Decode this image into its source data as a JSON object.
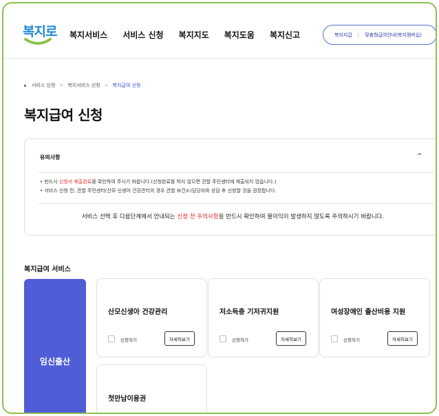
{
  "brand": {
    "logo_text": "복지로",
    "logo_color": "#1e88d6",
    "accent": "#4f5dd6",
    "frame_color": "#8cc152"
  },
  "nav": {
    "items": [
      "복지서비스",
      "서비스 신청",
      "복지지도",
      "복지도움",
      "복지신고"
    ]
  },
  "util": {
    "link1": "복지지갑",
    "separator": "|",
    "link2": "맞춤형급여안내(복지멤버십)"
  },
  "breadcrumb": {
    "items": [
      "서비스 신청",
      "복지서비스 신청",
      "복지급여 신청"
    ],
    "separator": ">"
  },
  "page": {
    "title": "복지급여 신청"
  },
  "notice": {
    "title": "유의사항",
    "toggle_icon": "^",
    "line1_prefix": "• 반드시 ",
    "line1_highlight": "신청서 제출완료",
    "line1_suffix": "를 확인하여 주시기 바랍니다.(신청완료를 하지 않으면 관할 주민센터에 제출되지 않습니다.)",
    "line2": "• 서비스 신청 전, 관할 주민센터(산모·신생아 건강관리의 경우 관할 보건소)담당자와 상담 후 신청할 것을 권장합니다.",
    "bottom_prefix": "서비스 선택 후 다음단계에서 안내되는 ",
    "bottom_highlight": "신청 전 주의사항",
    "bottom_suffix": "을 반드시 확인하여 불이익이 발생하지 않도록 주의하시기 바랍니다."
  },
  "section": {
    "title": "복지급여 서비스"
  },
  "category": {
    "label": "임신출산"
  },
  "cards": [
    {
      "title": "산모신생아 건강관리",
      "apply_label": "신청하기",
      "detail_label": "자세히보기"
    },
    {
      "title": "저소득층 기저귀지원",
      "apply_label": "신청하기",
      "detail_label": "자세히보기"
    },
    {
      "title": "여성장애인 출산비용 지원",
      "apply_label": "신청하기",
      "detail_label": "자세히보기"
    },
    {
      "title": "첫만남이용권"
    }
  ]
}
